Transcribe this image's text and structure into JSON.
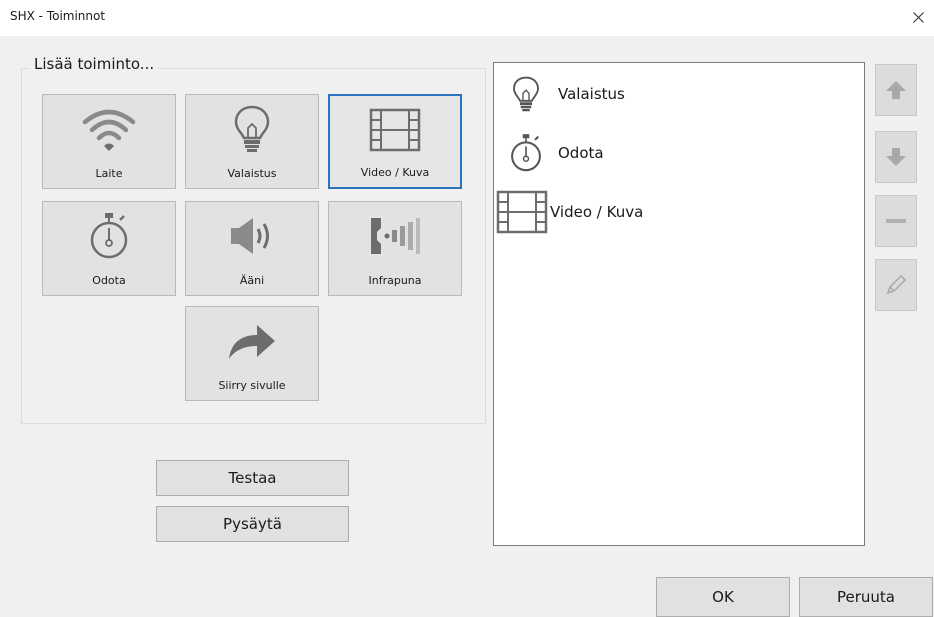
{
  "window": {
    "title": "SHX - Toiminnot"
  },
  "group": {
    "legend": "Lisää toiminto..."
  },
  "tiles": [
    {
      "label": "Laite",
      "icon": "wifi-icon"
    },
    {
      "label": "Valaistus",
      "icon": "lightbulb-icon"
    },
    {
      "label": "Video / Kuva",
      "icon": "film-icon",
      "selected": true
    },
    {
      "label": "Odota",
      "icon": "stopwatch-icon"
    },
    {
      "label": "Ääni",
      "icon": "speaker-icon"
    },
    {
      "label": "Infrapuna",
      "icon": "infrared-icon"
    },
    {
      "label": "Siirry sivulle",
      "icon": "arrow-forward-icon"
    }
  ],
  "actions": {
    "test_label": "Testaa",
    "stop_label": "Pysäytä"
  },
  "list": {
    "items": [
      {
        "label": "Valaistus",
        "icon": "lightbulb-icon"
      },
      {
        "label": "Odota",
        "icon": "stopwatch-icon"
      },
      {
        "label": "Video / Kuva",
        "icon": "film-icon"
      }
    ]
  },
  "side_buttons": [
    "move-up-icon",
    "move-down-icon",
    "remove-icon",
    "edit-icon"
  ],
  "dialog": {
    "ok_label": "OK",
    "cancel_label": "Peruuta"
  },
  "colors": {
    "selection": "#2b74c0",
    "icon_gray": "#6d6d6d",
    "disabled_icon": "#a8a8a8"
  }
}
